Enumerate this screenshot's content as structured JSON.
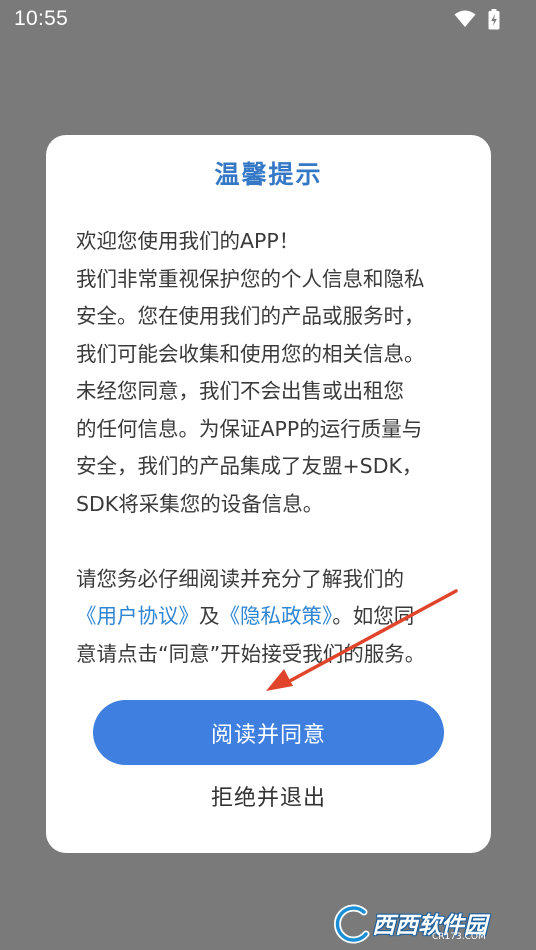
{
  "status_bar": {
    "time": "10:55"
  },
  "dialog": {
    "title": "温馨提示",
    "body_lines": [
      "欢迎您使用我们的APP！",
      "我们非常重视保护您的个人信息和隐私",
      "安全。您在使用我们的产品或服务时，",
      "我们可能会收集和使用您的相关信息。",
      "未经您同意，我们不会出售或出租您",
      "的任何信息。为保证APP的运行质量与",
      "安全，我们的产品集成了友盟+SDK，",
      "SDK将采集您的设备信息。"
    ],
    "notice_line_1": "请您务必仔细阅读并充分了解我们的",
    "link_user_agreement": "《用户协议》",
    "and_text": "及",
    "link_privacy_policy": "《隐私政策》",
    "notice_after_links": "。如您同",
    "notice_line_3": "意请点击“同意”开始接受我们的服务。",
    "agree_button": "阅读并同意",
    "reject_button": "拒绝并退出"
  },
  "colors": {
    "title": "#3578c6",
    "link": "#2f86d4",
    "agree_button_bg": "#3e7fe0",
    "annotation_arrow": "#e0452b",
    "overlay": "#7a7a7a"
  },
  "watermark": {
    "brand": "西西软件园",
    "url": "CR173.COM"
  }
}
